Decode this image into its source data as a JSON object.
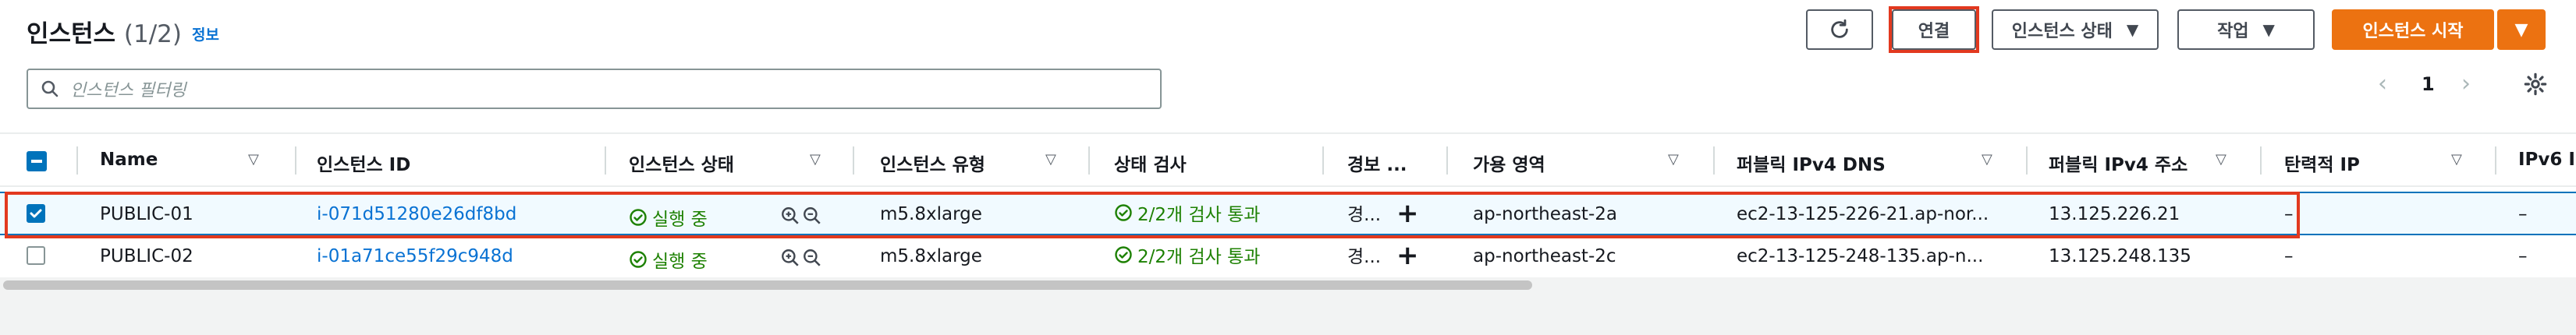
{
  "header": {
    "title": "인스턴스",
    "count": "(1/2)",
    "info_link": "정보"
  },
  "toolbar": {
    "connect_label": "연결",
    "instance_state_label": "인스턴스 상태",
    "actions_label": "작업",
    "launch_label": "인스턴스 시작"
  },
  "search": {
    "placeholder": "인스턴스 필터링"
  },
  "pagination": {
    "current_page": "1"
  },
  "columns": [
    "Name",
    "인스턴스 ID",
    "인스턴스 상태",
    "인스턴스 유형",
    "상태 검사",
    "경보 ...",
    "가용 영역",
    "퍼블릭 IPv4 DNS",
    "퍼블릭 IPv4 주소",
    "탄력적 IP",
    "IPv6 I"
  ],
  "rows": [
    {
      "selected": true,
      "name": "PUBLIC-01",
      "instance_id": "i-071d51280e26df8bd",
      "state": "실행 중",
      "type": "m5.8xlarge",
      "status_check": "2/2개 검사 통과",
      "alarm": "경...",
      "az": "ap-northeast-2a",
      "dns": "ec2-13-125-226-21.ap-nor...",
      "ipv4": "13.125.226.21",
      "elastic_ip": "–",
      "ipv6": "–"
    },
    {
      "selected": false,
      "name": "PUBLIC-02",
      "instance_id": "i-01a71ce55f29c948d",
      "state": "실행 중",
      "type": "m5.8xlarge",
      "status_check": "2/2개 검사 통과",
      "alarm": "경...",
      "az": "ap-northeast-2c",
      "dns": "ec2-13-125-248-135.ap-n...",
      "ipv4": "13.125.248.135",
      "elastic_ip": "–",
      "ipv6": "–"
    }
  ],
  "colors": {
    "accent": "#ec7211",
    "link": "#0972d3",
    "success": "#1d8102",
    "highlight": "#e2391f"
  }
}
